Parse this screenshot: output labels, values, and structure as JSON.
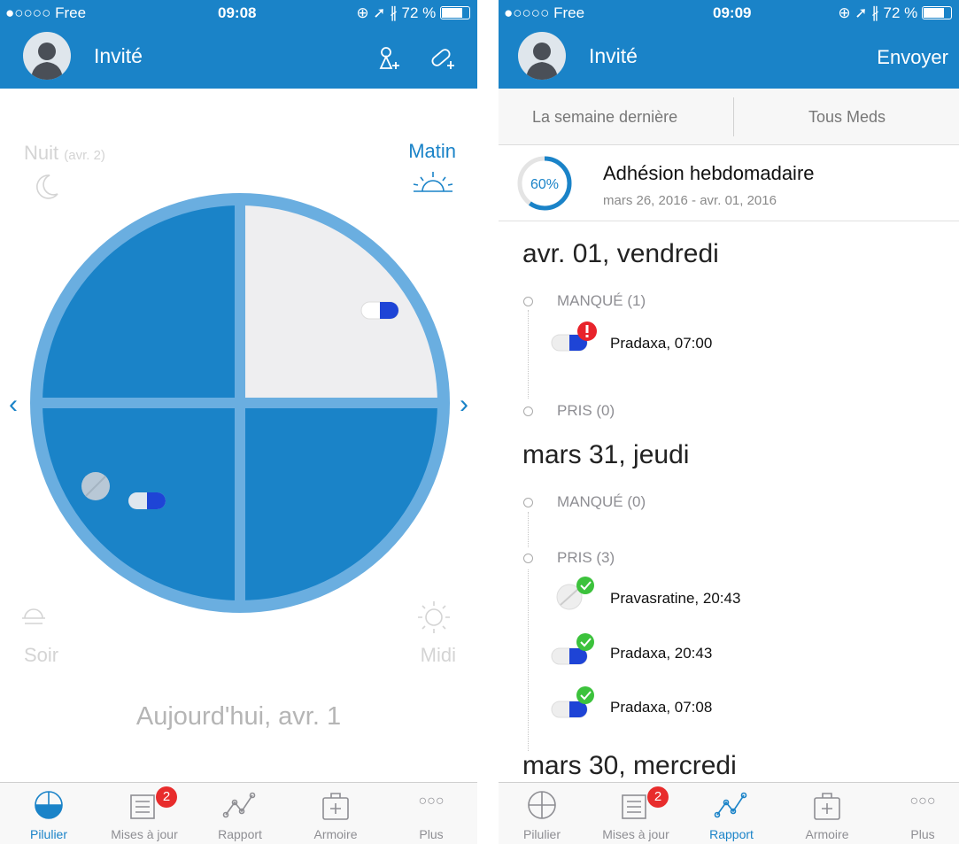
{
  "colors": {
    "brand": "#1a83c8",
    "quadrant_dark": "#1a83c8",
    "quadrant_light": "#eeeef0",
    "ring": "#6aaee0",
    "missed": "#e8232b",
    "taken": "#3cc23c"
  },
  "left": {
    "status": {
      "carrier": "●○○○○ Free",
      "time": "09:08",
      "battery": "72 %"
    },
    "header": {
      "title": "Invité",
      "icons": [
        "add-user-icon",
        "add-pill-icon"
      ]
    },
    "corners": {
      "night": "Nuit",
      "night_sub": "(avr. 2)",
      "morning": "Matin",
      "evening": "Soir",
      "noon": "Midi"
    },
    "today_label": "Aujourd'hui, avr. 1",
    "tabs": [
      {
        "label": "Pilulier",
        "icon": "pillbox-icon",
        "active": true
      },
      {
        "label": "Mises à jour",
        "icon": "news-icon",
        "badge": "2"
      },
      {
        "label": "Rapport",
        "icon": "report-icon"
      },
      {
        "label": "Armoire",
        "icon": "cabinet-icon"
      },
      {
        "label": "Plus",
        "icon": "more-icon"
      }
    ]
  },
  "right": {
    "status": {
      "carrier": "●○○○○ Free",
      "time": "09:09",
      "battery": "72 %"
    },
    "header": {
      "title": "Invité",
      "send": "Envoyer"
    },
    "segments": [
      "La semaine dernière",
      "Tous Meds"
    ],
    "adherence": {
      "percent_label": "60%",
      "percent": 60,
      "title": "Adhésion hebdomadaire",
      "range": "mars 26, 2016 - avr. 01, 2016"
    },
    "days": [
      {
        "date": "avr. 01, vendredi",
        "missed": "MANQUÉ (1)",
        "taken": "PRIS (0)",
        "missed_items": [
          "Pradaxa, 07:00"
        ]
      },
      {
        "date": "mars 31, jeudi",
        "missed": "MANQUÉ (0)",
        "taken": "PRIS (3)",
        "taken_items": [
          "Pravasratine, 20:43",
          "Pradaxa, 20:43",
          "Pradaxa, 07:08"
        ]
      },
      {
        "date": "mars 30, mercredi"
      }
    ],
    "tabs": [
      {
        "label": "Pilulier",
        "icon": "pillbox-icon"
      },
      {
        "label": "Mises à jour",
        "icon": "news-icon",
        "badge": "2"
      },
      {
        "label": "Rapport",
        "icon": "report-icon",
        "active": true
      },
      {
        "label": "Armoire",
        "icon": "cabinet-icon"
      },
      {
        "label": "Plus",
        "icon": "more-icon"
      }
    ]
  }
}
